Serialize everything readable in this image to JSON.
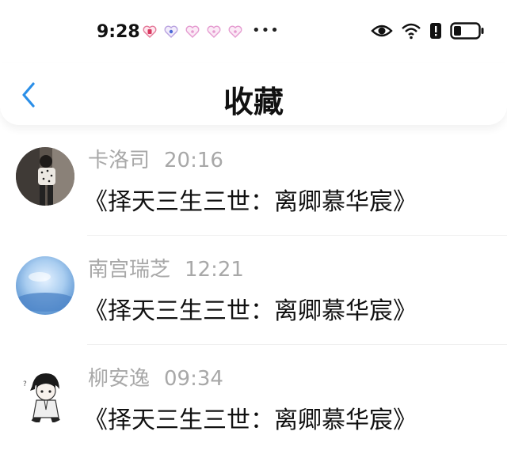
{
  "status_bar": {
    "time": "9:28",
    "more_indicator": "•••",
    "notification_icons": [
      "heart-notification-icon",
      "heart-notification-icon",
      "heart-notification-icon",
      "heart-notification-icon",
      "heart-notification-icon"
    ],
    "system_icons": [
      "eye-icon",
      "wifi-icon",
      "alert-icon",
      "battery-icon"
    ]
  },
  "header": {
    "title": "收藏",
    "back_icon": "chevron-left-icon"
  },
  "colors": {
    "accent": "#2b8fe8",
    "secondary_text": "#a8a8a8",
    "primary_text": "#111111"
  },
  "items": [
    {
      "name": "卡洛司",
      "time": "20:16",
      "message": "《择天三生三世：离卿慕华宸》",
      "avatar_icon": "photo-avatar"
    },
    {
      "name": "南宫瑞芝",
      "time": "12:21",
      "message": "《择天三生三世：离卿慕华宸》",
      "avatar_icon": "blue-sky-avatar"
    },
    {
      "name": "柳安逸",
      "time": "09:34",
      "message": "《择天三生三世：离卿慕华宸》",
      "avatar_icon": "anime-avatar"
    }
  ]
}
